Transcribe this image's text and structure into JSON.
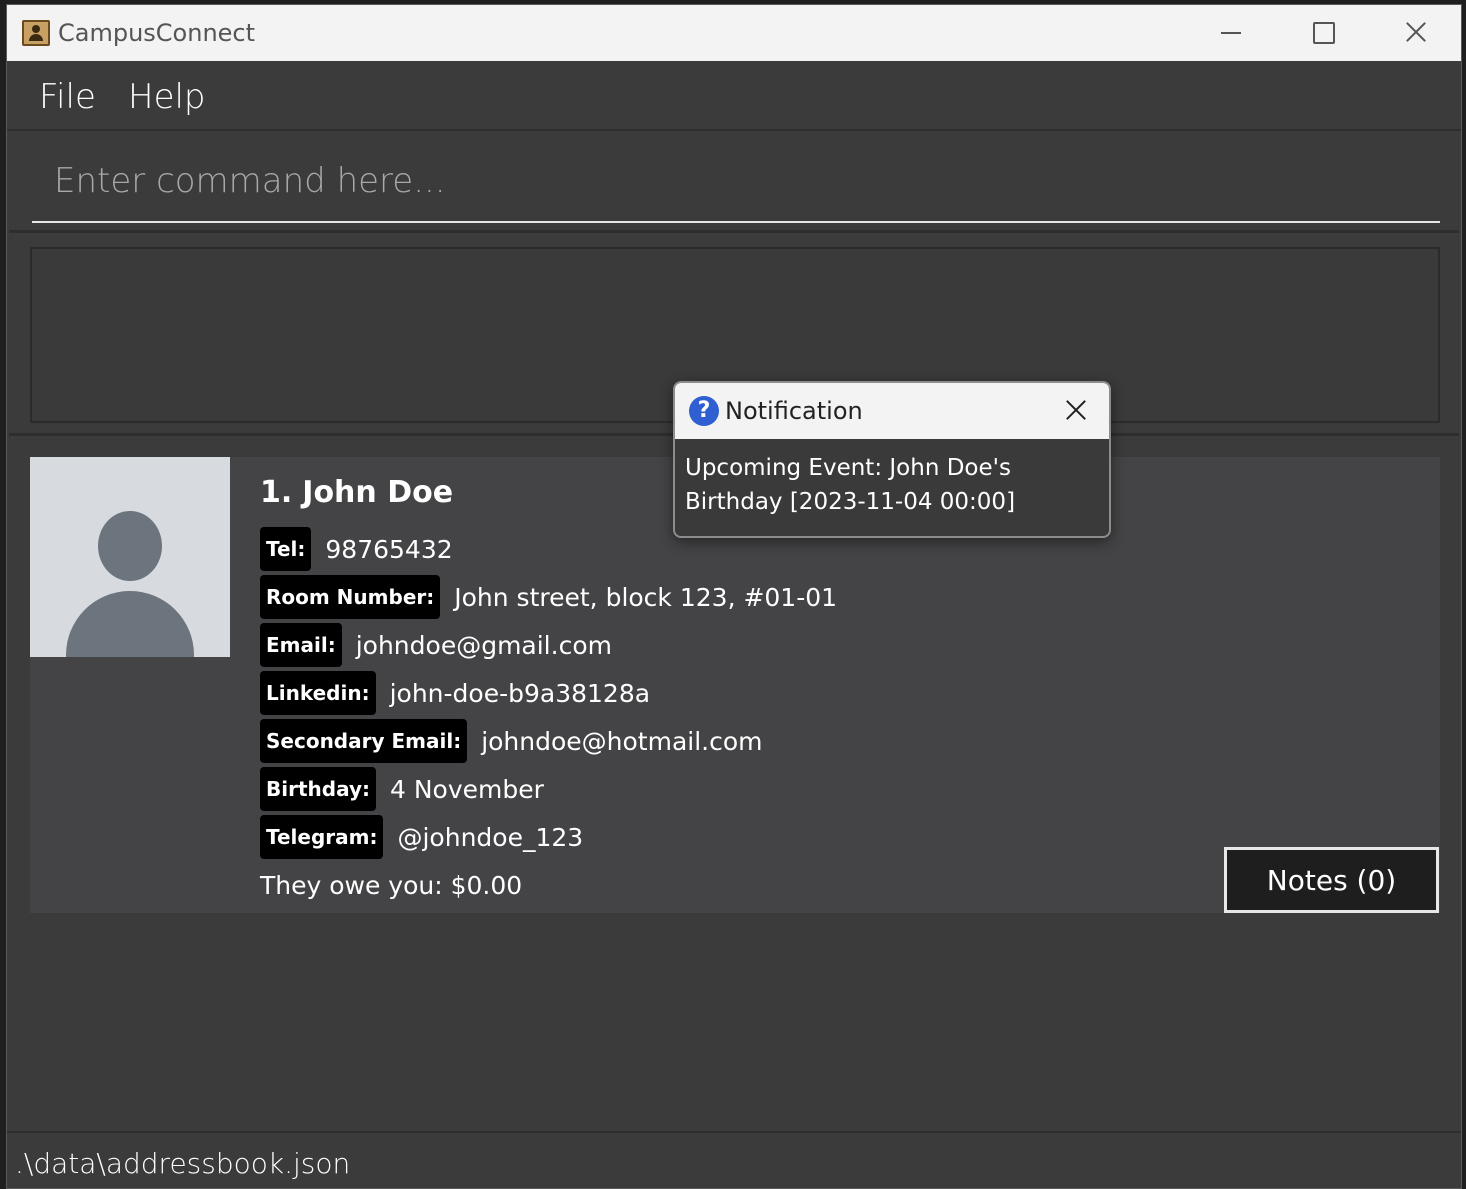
{
  "window": {
    "title": "CampusConnect",
    "controls": [
      "minimize-icon",
      "maximize-icon",
      "close-icon"
    ]
  },
  "menu": {
    "file": "File",
    "help": "Help"
  },
  "command": {
    "placeholder": "Enter command here...",
    "value": ""
  },
  "result": {
    "text": ""
  },
  "persons": [
    {
      "index": "1.",
      "name": "John Doe",
      "fields": [
        {
          "label": "Tel:",
          "value": "98765432"
        },
        {
          "label": "Room Number:",
          "value": "John street, block 123, #01-01"
        },
        {
          "label": "Email:",
          "value": "johndoe@gmail.com"
        },
        {
          "label": "Linkedin:",
          "value": "john-doe-b9a38128a"
        },
        {
          "label": "Secondary Email:",
          "value": "johndoe@hotmail.com"
        },
        {
          "label": "Birthday:",
          "value": "4 November"
        },
        {
          "label": "Telegram:",
          "value": "@johndoe_123"
        }
      ],
      "owe": "They owe you: $0.00",
      "notes_button": "Notes (0)"
    }
  ],
  "status": {
    "path": ".\\data\\addressbook.json"
  },
  "notification": {
    "title": "Notification",
    "icon": "question-icon",
    "icon_glyph": "?",
    "message": "Upcoming Event: John Doe's Birthday [2023-11-04 00:00]"
  }
}
